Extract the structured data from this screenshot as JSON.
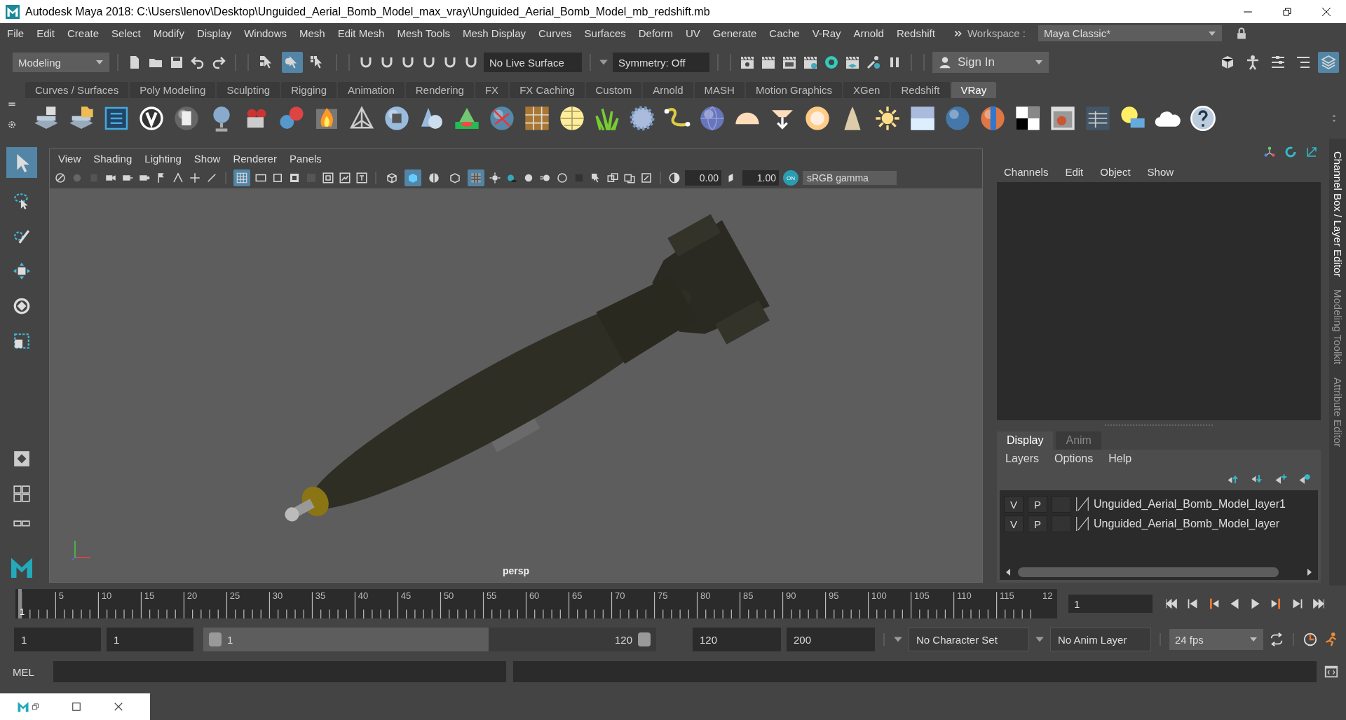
{
  "window": {
    "title": "Autodesk Maya 2018: C:\\Users\\lenov\\Desktop\\Unguided_Aerial_Bomb_Model_max_vray\\Unguided_Aerial_Bomb_Model_mb_redshift.mb"
  },
  "menu_bar": [
    "File",
    "Edit",
    "Create",
    "Select",
    "Modify",
    "Display",
    "Windows",
    "Mesh",
    "Edit Mesh",
    "Mesh Tools",
    "Mesh Display",
    "Curves",
    "Surfaces",
    "Deform",
    "UV",
    "Generate",
    "Cache",
    "V-Ray",
    "Arnold",
    "Redshift"
  ],
  "workspace": {
    "label": "Workspace :",
    "value": "Maya Classic*"
  },
  "status_line": {
    "menu_set": "Modeling",
    "selection_mask_buttons": [
      {
        "selected": false
      },
      {
        "selected": true
      },
      {
        "selected": false
      }
    ],
    "live_surface": "No Live Surface",
    "symmetry": "Symmetry: Off",
    "sign_in": "Sign In",
    "panel_buttons": [
      {
        "selected": false
      },
      {
        "selected": false
      },
      {
        "selected": false
      },
      {
        "selected": false
      },
      {
        "selected": true
      }
    ]
  },
  "shelf": {
    "tabs": [
      {
        "label": "Curves / Surfaces",
        "selected": false
      },
      {
        "label": "Poly Modeling",
        "selected": false
      },
      {
        "label": "Sculpting",
        "selected": false
      },
      {
        "label": "Rigging",
        "selected": false
      },
      {
        "label": "Animation",
        "selected": false
      },
      {
        "label": "Rendering",
        "selected": false
      },
      {
        "label": "FX",
        "selected": false
      },
      {
        "label": "FX Caching",
        "selected": false
      },
      {
        "label": "Custom",
        "selected": false
      },
      {
        "label": "Arnold",
        "selected": false
      },
      {
        "label": "MASH",
        "selected": false
      },
      {
        "label": "Motion Graphics",
        "selected": false
      },
      {
        "label": "XGen",
        "selected": false
      },
      {
        "label": "Redshift",
        "selected": false
      },
      {
        "label": "VRay",
        "selected": true
      }
    ]
  },
  "toolbox": {
    "tools": [
      {
        "selected": true
      },
      {
        "selected": false
      },
      {
        "selected": false
      },
      {
        "selected": false
      },
      {
        "selected": false
      },
      {
        "selected": false
      }
    ]
  },
  "viewport": {
    "menus": [
      "View",
      "Shading",
      "Lighting",
      "Show",
      "Renderer",
      "Panels"
    ],
    "grid_button": {
      "selected": true
    },
    "shading_buttons": [
      {
        "selected": false
      },
      {
        "selected": true
      },
      {
        "selected": false
      },
      {
        "selected": false
      },
      {
        "selected": true
      }
    ],
    "exposure": "0.00",
    "gamma": "1.00",
    "color_management": {
      "enabled": true,
      "badge": "ON",
      "label": "sRGB gamma"
    },
    "camera": "persp"
  },
  "channel_box": {
    "menus": [
      "Channels",
      "Edit",
      "Object",
      "Show"
    ]
  },
  "layer_editor": {
    "tabs": [
      {
        "label": "Display",
        "selected": true
      },
      {
        "label": "Anim",
        "selected": false
      }
    ],
    "menus": [
      "Layers",
      "Options",
      "Help"
    ],
    "layers": [
      {
        "visibility": "V",
        "playback": "P",
        "name": "Unguided_Aerial_Bomb_Model_layer1"
      },
      {
        "visibility": "V",
        "playback": "P",
        "name": "Unguided_Aerial_Bomb_Model_layer"
      }
    ]
  },
  "side_tabs": [
    {
      "label": "Channel Box / Layer Editor",
      "selected": true
    },
    {
      "label": "Modeling Toolkit",
      "selected": false
    },
    {
      "label": "Attribute Editor",
      "selected": false
    }
  ],
  "time_slider": {
    "ticks": [
      "1",
      "5",
      "10",
      "15",
      "20",
      "25",
      "30",
      "35",
      "40",
      "45",
      "50",
      "55",
      "60",
      "65",
      "70",
      "75",
      "80",
      "85",
      "90",
      "95",
      "100",
      "105",
      "110",
      "115",
      "12"
    ],
    "current_frame": "1"
  },
  "range_slider": {
    "start": "1",
    "playback_start": "1",
    "range_start": "1",
    "range_end": "120",
    "playback_end": "120",
    "end": "200",
    "character_set": "No Character Set",
    "anim_layer": "No Anim Layer",
    "fps": "24 fps"
  },
  "command_line": {
    "language": "MEL"
  }
}
